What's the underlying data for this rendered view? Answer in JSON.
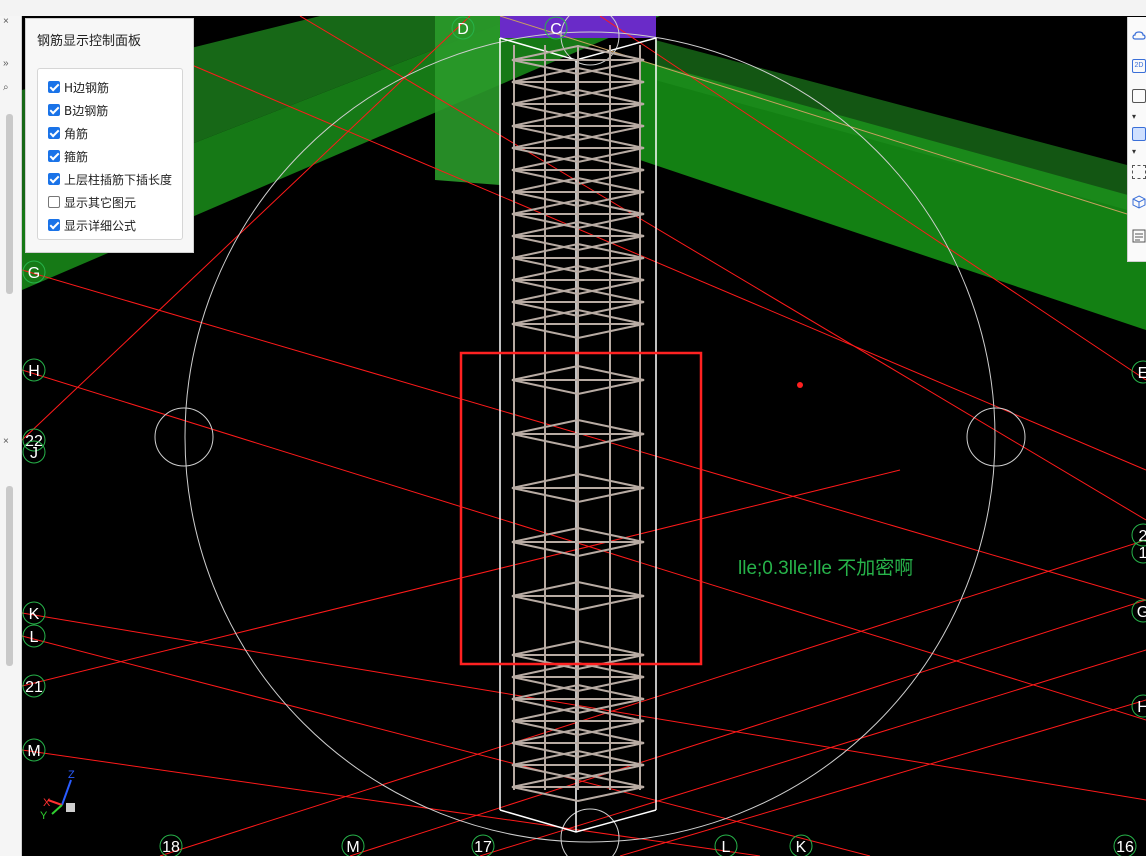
{
  "panel": {
    "title": "钢筋显示控制面板",
    "options": [
      {
        "label": "H边钢筋",
        "checked": true
      },
      {
        "label": "B边钢筋",
        "checked": true
      },
      {
        "label": "角筋",
        "checked": true
      },
      {
        "label": "箍筋",
        "checked": true
      },
      {
        "label": "上层柱插筋下插长度",
        "checked": true
      },
      {
        "label": "显示其它图元",
        "checked": false
      },
      {
        "label": "显示详细公式",
        "checked": true
      }
    ]
  },
  "annotation": {
    "text": "lle;0.3lle;lle 不加密啊",
    "color": "#27b34a"
  },
  "grid_labels": {
    "left": [
      "G",
      "H",
      "22",
      "J",
      "K",
      "L",
      "21",
      "M"
    ],
    "top": [
      "D",
      "C"
    ],
    "bottom": [
      "18",
      "M",
      "17",
      "L",
      "K",
      "16"
    ],
    "right": [
      "E",
      "2",
      "1",
      "G",
      "H"
    ]
  },
  "axis_gizmo": {
    "x": "X",
    "y": "Y",
    "z": "Z"
  },
  "left_strip": {
    "close_glyph": "×",
    "expand_glyph": "»",
    "search_glyph": "⌕"
  },
  "right_toolbar": {
    "icons": [
      "cloud-icon",
      "2d-view-icon",
      "box-view-icon",
      "box-solid-icon",
      "dropdown-icon",
      "select-icon",
      "3d-view-icon",
      "list-icon"
    ],
    "label_2d": "2D"
  },
  "colors": {
    "grid_red": "#ff1a1a",
    "slab_green": "#1f8f1f",
    "rebar": "#b8aba3",
    "highlight": "#ff2222",
    "column_top": "#7a2fd0"
  }
}
